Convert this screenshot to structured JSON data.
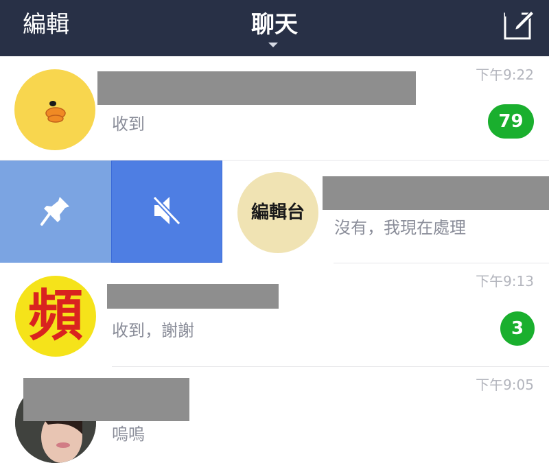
{
  "header": {
    "edit_label": "編輯",
    "title": "聊天",
    "bg_color": "#283046"
  },
  "chats": [
    {
      "subtitle": "收到",
      "time": "下午9:22",
      "badge": "79",
      "avatar": "sally-duck-avatar"
    },
    {
      "subtitle": "沒有，我現在處理",
      "avatar_text": "編輯台",
      "swipe_actions": [
        "pin-icon",
        "mute-icon"
      ]
    },
    {
      "subtitle": "收到，謝謝",
      "time": "下午9:13",
      "badge": "3",
      "avatar_text": "頻"
    },
    {
      "subtitle": "嗚嗚",
      "time": "下午9:05",
      "avatar": "woman-photo-avatar"
    }
  ],
  "colors": {
    "badge": "#1aaf2e",
    "pin_action": "#7ba4e2",
    "mute_action": "#4e7ee3"
  }
}
